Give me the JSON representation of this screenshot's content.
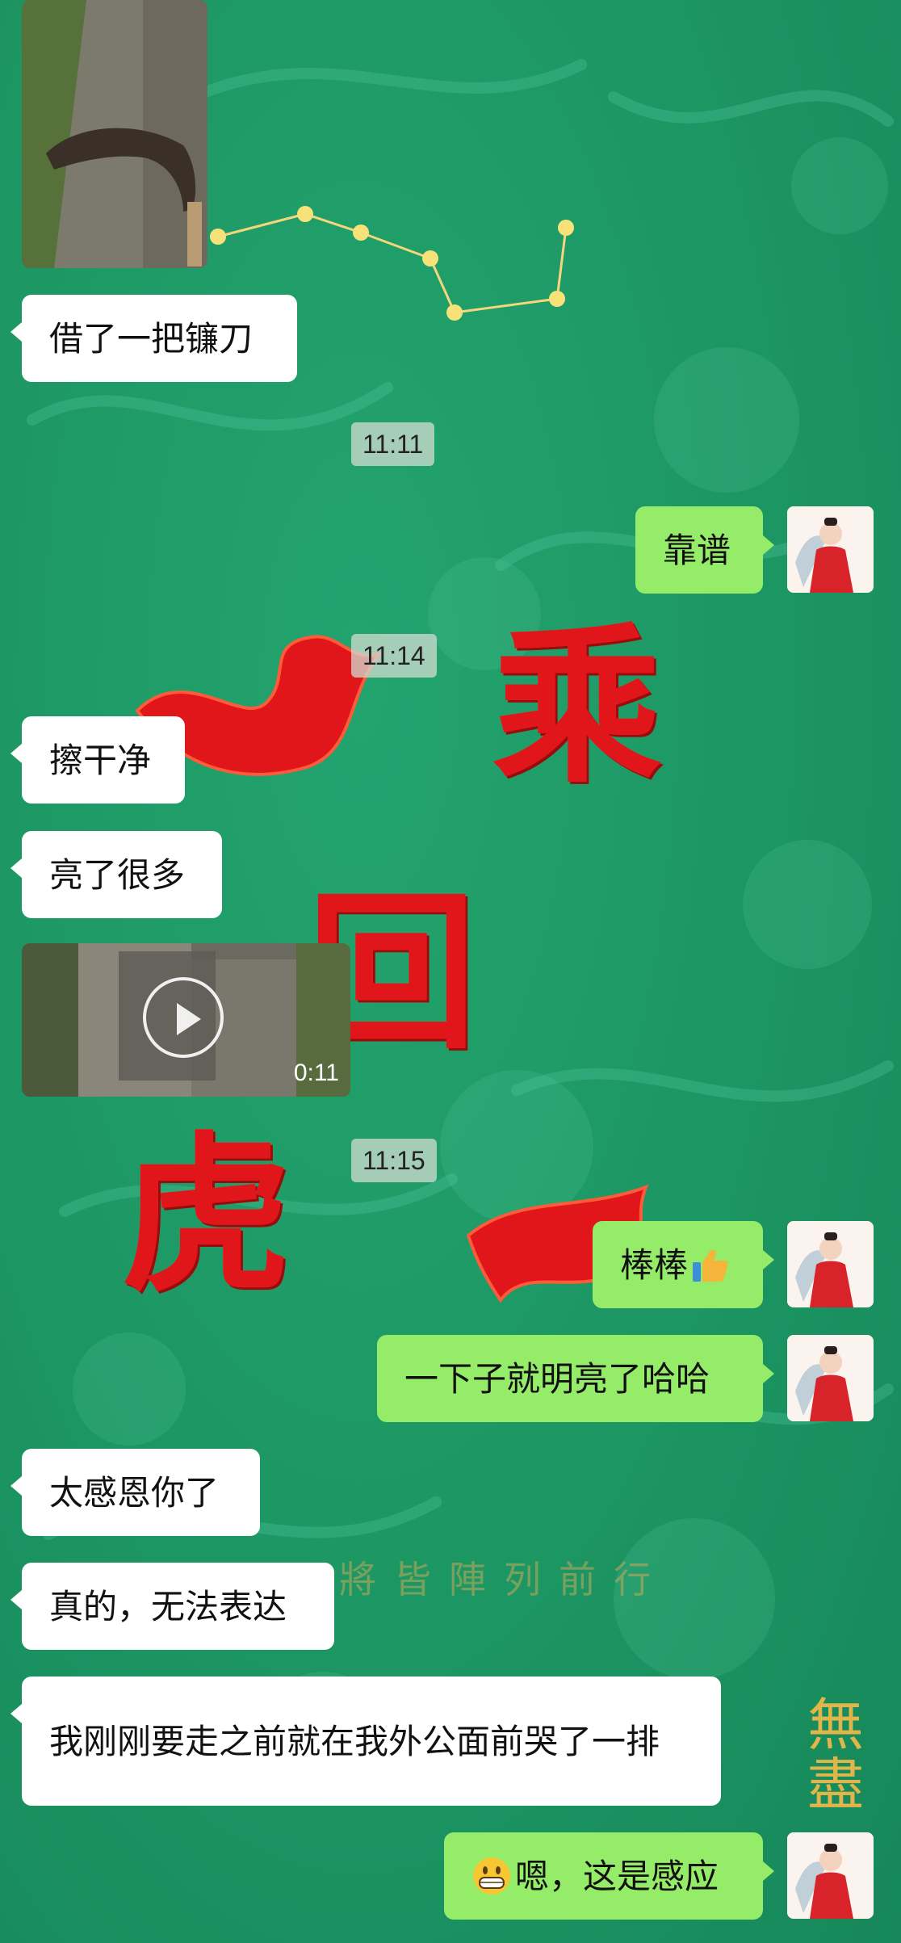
{
  "background": {
    "big_chars": [
      "",
      "",
      "",
      ""
    ],
    "caption": "將皆陣列前行",
    "signature": "無盡"
  },
  "messages": [
    {
      "id": "m1",
      "side": "left",
      "type": "image",
      "desc": "sickle-photo"
    },
    {
      "id": "m2",
      "side": "left",
      "type": "text",
      "text": "借了一把镰刀"
    },
    {
      "id": "t1",
      "type": "time",
      "text": "11:11"
    },
    {
      "id": "m3",
      "side": "right",
      "type": "text",
      "text": "靠谱"
    },
    {
      "id": "t2",
      "type": "time",
      "text": "11:14"
    },
    {
      "id": "m4",
      "side": "left",
      "type": "text",
      "text": "擦干净"
    },
    {
      "id": "m5",
      "side": "left",
      "type": "text",
      "text": "亮了很多"
    },
    {
      "id": "m6",
      "side": "left",
      "type": "video",
      "duration": "0:11"
    },
    {
      "id": "t3",
      "type": "time",
      "text": "11:15"
    },
    {
      "id": "m7",
      "side": "right",
      "type": "text",
      "text": "棒棒",
      "emoji": "thumbs-up-icon"
    },
    {
      "id": "m8",
      "side": "right",
      "type": "text",
      "text": "一下子就明亮了哈哈"
    },
    {
      "id": "m9",
      "side": "left",
      "type": "text",
      "text": "太感恩你了"
    },
    {
      "id": "m10",
      "side": "left",
      "type": "text",
      "text": "真的，无法表达"
    },
    {
      "id": "m11",
      "side": "left",
      "type": "text",
      "text": "我刚刚要走之前就在我外公面前哭了一排"
    },
    {
      "id": "m12",
      "side": "right",
      "type": "text",
      "text": "嗯，这是感应",
      "emoji": "grin-icon"
    }
  ],
  "colors": {
    "bg": "#1c9663",
    "right_bubble": "#95ec69",
    "left_bubble": "#ffffff",
    "brush_red": "#e0161a"
  }
}
